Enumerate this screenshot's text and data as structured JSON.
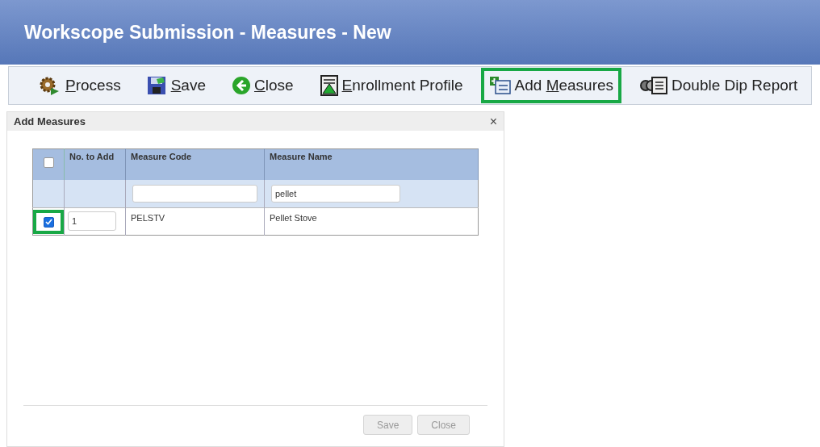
{
  "window": {
    "title": "Workscope Submission - Measures - New"
  },
  "toolbar": [
    {
      "kind": "gear",
      "key": "P",
      "after": "rocess",
      "highlighted": false
    },
    {
      "kind": "disk",
      "key": "S",
      "after": "ave",
      "highlighted": false
    },
    {
      "kind": "back",
      "key": "C",
      "after": "lose",
      "highlighted": false
    },
    {
      "kind": "profile",
      "key": "E",
      "after": "nrollment Profile",
      "highlighted": false
    },
    {
      "kind": "add",
      "before": "Add ",
      "key": "M",
      "after": "easures",
      "highlighted": true
    },
    {
      "kind": "report",
      "before": "Double Dip Report",
      "highlighted": false
    }
  ],
  "dialog": {
    "title": "Add Measures",
    "close": "×",
    "select_all_checked": false,
    "columns": [
      "No. to Add",
      "Measure Code",
      "Measure Name"
    ],
    "filters": {
      "name": {
        "value": "pellet"
      }
    },
    "rows": [
      {
        "checked": true,
        "highlighted": true,
        "count": "1",
        "code": "PELSTV",
        "name": "Pellet Stove"
      }
    ],
    "buttons": [
      "Save",
      "Close"
    ]
  }
}
